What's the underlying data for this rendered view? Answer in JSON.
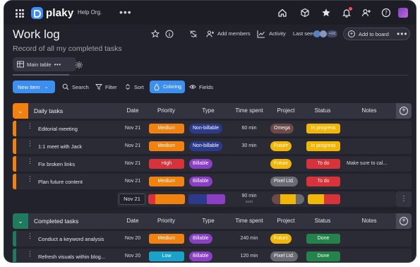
{
  "app": {
    "brand": "plaky",
    "org": "Help Org."
  },
  "board": {
    "title": "Work log",
    "subtitle": "Record of all my completed tasks",
    "add_members": "Add members",
    "activity": "Activity",
    "last_seen": "Last seen",
    "last_seen_count": "+10",
    "add_to_board": "Add to board"
  },
  "views": {
    "main_table": "Main table"
  },
  "toolbar": {
    "new_item": "New Item",
    "search": "Search",
    "filter": "Filter",
    "sort": "Sort",
    "coloring": "Coloring",
    "fields": "Fields"
  },
  "columns": [
    "Date",
    "Priority",
    "Type",
    "Time spent",
    "Project",
    "Status",
    "Notes"
  ],
  "colors": {
    "orange": "#f2820f",
    "red": "#d8323b",
    "green": "#24834a",
    "teal": "#1f7a5e",
    "yellow": "#f2b705",
    "blue": "#3c8ff0",
    "navy": "#2c3a8c",
    "purple": "#8a3fc4",
    "omega": "#6b4a48",
    "pixel": "#6b6b74"
  },
  "groups": [
    {
      "name": "Daily tasks",
      "rows": [
        {
          "name": "Editorial meeting",
          "date": "Nov 21",
          "priority": "Medium",
          "type": "Non-billable",
          "time": "60 min",
          "project": "Omega",
          "status": "In progress",
          "notes": ""
        },
        {
          "name": "1:1 meet with Jack",
          "date": "Nov 21",
          "priority": "Medium",
          "type": "Non-billable",
          "time": "30 min",
          "project": "Future",
          "status": "In progress",
          "notes": ""
        },
        {
          "name": "Fix broken links",
          "date": "Nov 21",
          "priority": "High",
          "type": "Billable",
          "time": "",
          "project": "Future",
          "status": "To do",
          "notes": "Make sure to cal..."
        },
        {
          "name": "Plan future content",
          "date": "Nov 21",
          "priority": "Medium",
          "type": "Billable",
          "time": "",
          "project": "Pixel Ltd.",
          "status": "To do",
          "notes": ""
        }
      ],
      "summary": {
        "date": "Nov 21",
        "time": "90 min",
        "time_label": "sum"
      }
    },
    {
      "name": "Completed tasks",
      "rows": [
        {
          "name": "Conduct a keyword analysis",
          "date": "Nov 20",
          "priority": "Medium",
          "type": "Billable",
          "time": "240 min",
          "project": "Future",
          "status": "Done",
          "notes": ""
        },
        {
          "name": "Refresh visuals within blog...",
          "date": "Nov 20",
          "priority": "Low",
          "type": "Billable",
          "time": "120 min",
          "project": "Pixel Ltd.",
          "status": "Done",
          "notes": ""
        }
      ]
    }
  ]
}
